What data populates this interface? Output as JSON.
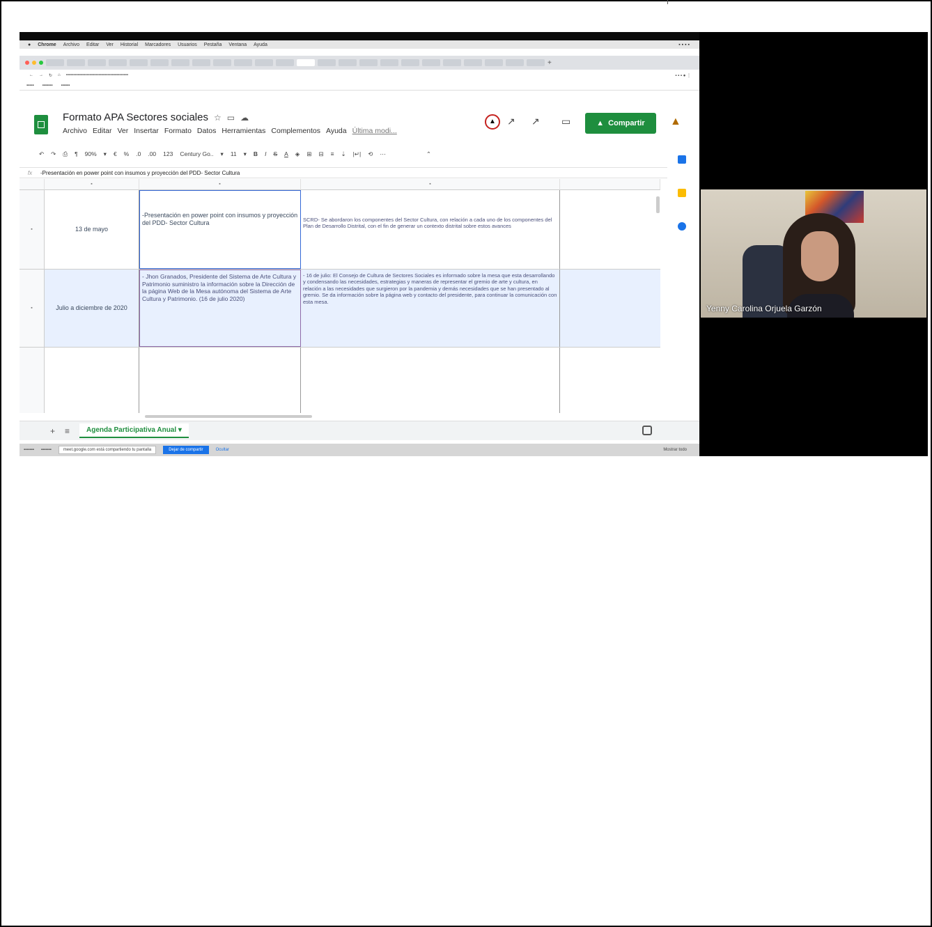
{
  "mac_menu": [
    "Chrome",
    "Archivo",
    "Editar",
    "Ver",
    "Historial",
    "Marcadores",
    "Usuarios",
    "Pestaña",
    "Ventana",
    "Ayuda"
  ],
  "doc": {
    "title": "Formato APA Sectores sociales",
    "menu": [
      "Archivo",
      "Editar",
      "Ver",
      "Insertar",
      "Formato",
      "Datos",
      "Herramientas",
      "Complementos",
      "Ayuda"
    ],
    "last_edit": "Última modi...",
    "share_label": "Compartir"
  },
  "toolbar": {
    "zoom": "90%",
    "number_format": "123",
    "font": "Century Go..",
    "font_size": "11"
  },
  "formula_bar": {
    "fx": "fx",
    "value": "-Presentación en power point con insumos y proyección del PDD- Sector Cultura"
  },
  "grid": {
    "rows": [
      {
        "date": "13 de mayo",
        "activity": "-Presentación en power point con insumos y proyección del PDD- Sector Cultura",
        "result": "SCRD- Se abordaron los componentes del Sector Cultura, con relación a cada uno de los componentes del Plan de Desarrollo Distrital, con el fin de generar un contexto distrital sobre estos avances"
      },
      {
        "date": "Julio a diciembre de 2020",
        "activity": "- Jhon Granados, Presidente del Sistema de Arte Cultura y Patrimonio suministro la información sobre la Dirección de la página Web de la Mesa autónoma del Sistema de Arte Cultura y Patrimonio. (16 de julio 2020)",
        "result": "- 16 de julio: El Consejo de Cultura de Sectores Sociales es informado sobre la mesa que esta desarrollando y condensando las necesidades, estrategias y maneras de representar el gremio de arte y cultura, en relación a las necesidades que surgieron por la pandemia y demás necesidades que se han presentado al gremio. Se da información sobre la página web y contacto del presidente, para continuar la comunicación con esta mesa."
      },
      {
        "date": "",
        "activity": "",
        "result": ""
      }
    ]
  },
  "sheet_tab": "Agenda Participativa Anual",
  "download_bar": {
    "notice": "meet.google.com está compartiendo tu pantalla",
    "stop_button": "Dejar de compartir",
    "hide_link": "Ocultar",
    "show_all": "Mostrar todo"
  },
  "participant": {
    "name": "Yenny Carolina Orjuela Garzón"
  }
}
